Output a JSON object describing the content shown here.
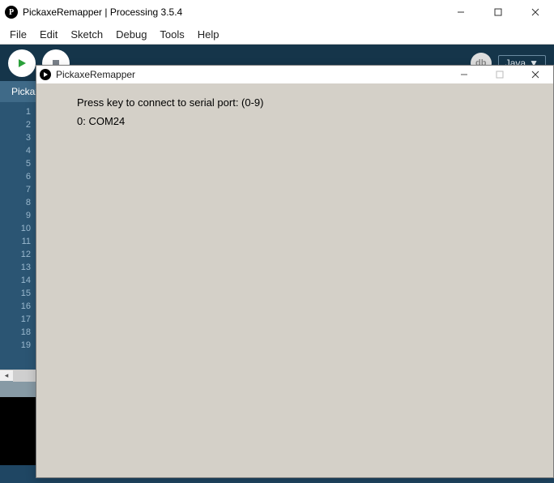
{
  "window": {
    "title": "PickaxeRemapper | Processing 3.5.4",
    "icon_letter": "P"
  },
  "menu": [
    "File",
    "Edit",
    "Sketch",
    "Debug",
    "Tools",
    "Help"
  ],
  "toolbar": {
    "debug_label": "db",
    "mode_label": "Java",
    "mode_arrow": "▼"
  },
  "tab": {
    "name": "PickaxeRemapper",
    "dropdown": "▾"
  },
  "gutter_lines": [
    "1",
    "2",
    "3",
    "4",
    "5",
    "6",
    "7",
    "8",
    "9",
    "10",
    "11",
    "12",
    "13",
    "14",
    "15",
    "16",
    "17",
    "18",
    "19"
  ],
  "dialog": {
    "title": "PickaxeRemapper",
    "line1": "Press key to connect to serial port: (0-9)",
    "line2": "0: COM24"
  }
}
